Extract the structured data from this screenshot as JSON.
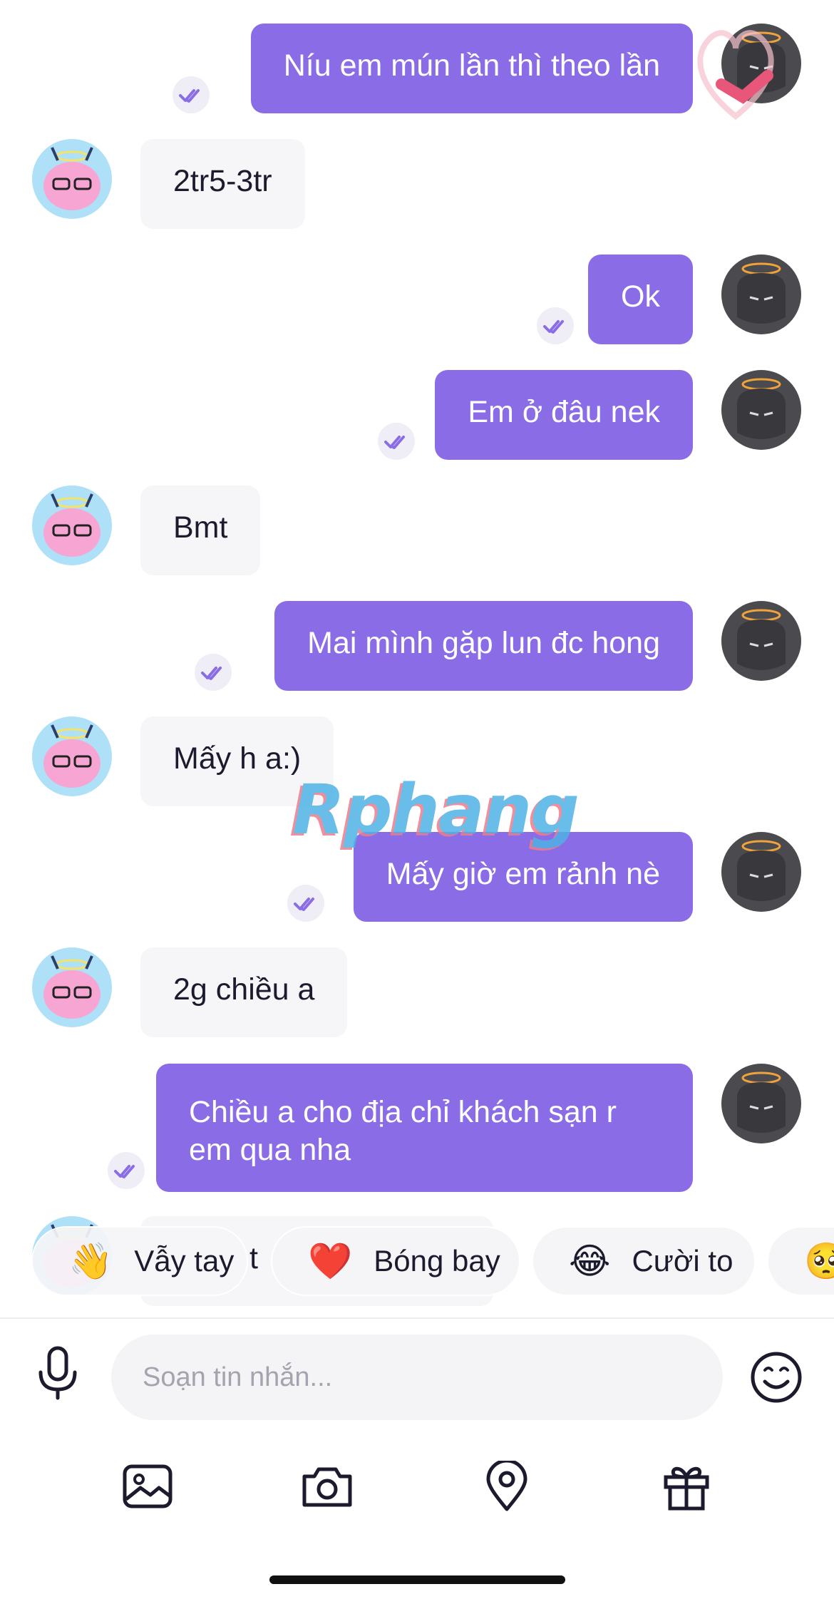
{
  "messages": [
    {
      "side": "me",
      "text": "Níu em mún lần thì theo lần"
    },
    {
      "side": "them",
      "text": "2tr5-3tr"
    },
    {
      "side": "me",
      "text": "Ok"
    },
    {
      "side": "me",
      "text": "Em ở đâu nek"
    },
    {
      "side": "them",
      "text": "Bmt"
    },
    {
      "side": "me",
      "text": "Mai mình gặp lun đc hong"
    },
    {
      "side": "them",
      "text": "Mấy h a:)"
    },
    {
      "side": "me",
      "text": "Mấy giờ em rảnh nè"
    },
    {
      "side": "them",
      "text": "2g chiều a"
    },
    {
      "side": "me",
      "text_line1": "Chiều a cho địa chỉ khách sạn r",
      "text_line2": "em qua nha"
    },
    {
      "side": "them",
      "text": "t"
    }
  ],
  "watermark": "Rphang",
  "reactions": [
    {
      "emoji": "👋",
      "label": "Vẫy tay"
    },
    {
      "emoji": "❤️",
      "label": "Bóng bay"
    },
    {
      "emoji": "😂",
      "label": "Cười to"
    },
    {
      "emoji": "🥺",
      "label": ""
    }
  ],
  "composer": {
    "placeholder": "Soạn tin nhắn..."
  },
  "icons": {
    "mic": "microphone-icon",
    "emoji": "emoji-icon",
    "image": "image-icon",
    "camera": "camera-icon",
    "location": "location-pin-icon",
    "gift": "gift-icon",
    "read": "double-check-icon"
  },
  "colors": {
    "accent": "#8a6de6",
    "bubble_them": "#f6f6f9",
    "read_check": "#8a6de6"
  }
}
